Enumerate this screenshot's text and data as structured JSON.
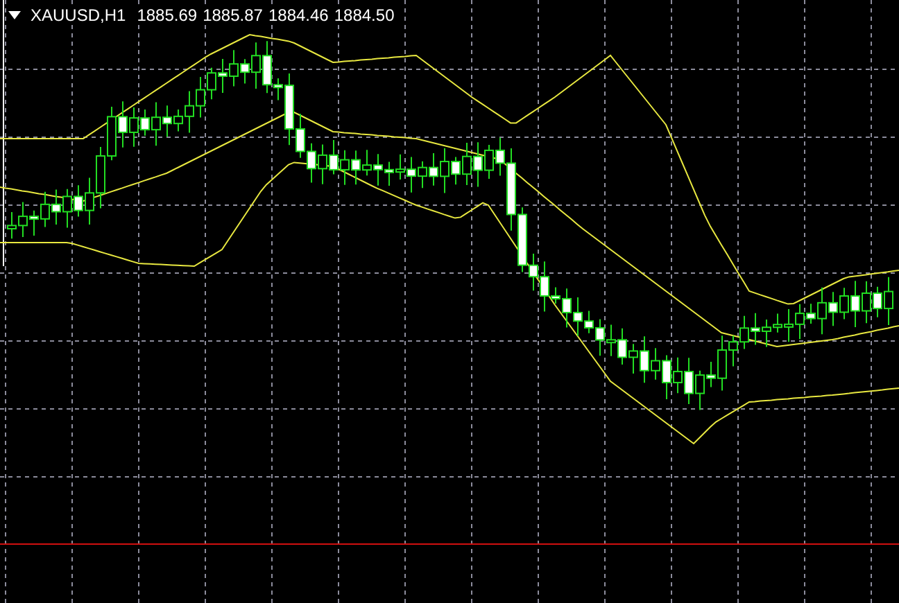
{
  "chart": {
    "symbol_caption": "XAUUSD,H1",
    "quotes": [
      "1885.69",
      "1885.87",
      "1884.46",
      "1884.50"
    ]
  }
}
